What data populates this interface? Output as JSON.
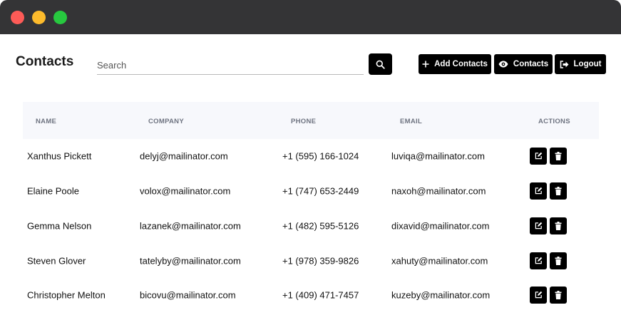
{
  "window": {
    "controls": [
      "close",
      "minimize",
      "maximize"
    ]
  },
  "header": {
    "title": "Contacts",
    "search_placeholder": "Search",
    "search_value": "",
    "buttons": {
      "add": "Add Contacts",
      "contacts": "Contacts",
      "logout": "Logout"
    }
  },
  "table": {
    "columns": [
      "NAME",
      "COMPANY",
      "PHONE",
      "EMAIL",
      "ACTIONS"
    ],
    "rows": [
      {
        "name": "Xanthus Pickett",
        "company": "delyj@mailinator.com",
        "phone": "+1 (595) 166-1024",
        "email": "luviqa@mailinator.com"
      },
      {
        "name": "Elaine Poole",
        "company": "volox@mailinator.com",
        "phone": "+1 (747) 653-2449",
        "email": "naxoh@mailinator.com"
      },
      {
        "name": "Gemma Nelson",
        "company": "lazanek@mailinator.com",
        "phone": "+1 (482) 595-5126",
        "email": "dixavid@mailinator.com"
      },
      {
        "name": "Steven Glover",
        "company": "tatelyby@mailinator.com",
        "phone": "+1 (978) 359-9826",
        "email": "xahuty@mailinator.com"
      },
      {
        "name": "Christopher Melton",
        "company": "bicovu@mailinator.com",
        "phone": "+1 (409) 471-7457",
        "email": "kuzeby@mailinator.com"
      }
    ],
    "row_actions": [
      "edit-icon",
      "trash-icon"
    ]
  },
  "colors": {
    "titlebar": "#343436",
    "button": "#000000",
    "header_bg": "#f7f8fc",
    "header_text": "#6e7380"
  }
}
